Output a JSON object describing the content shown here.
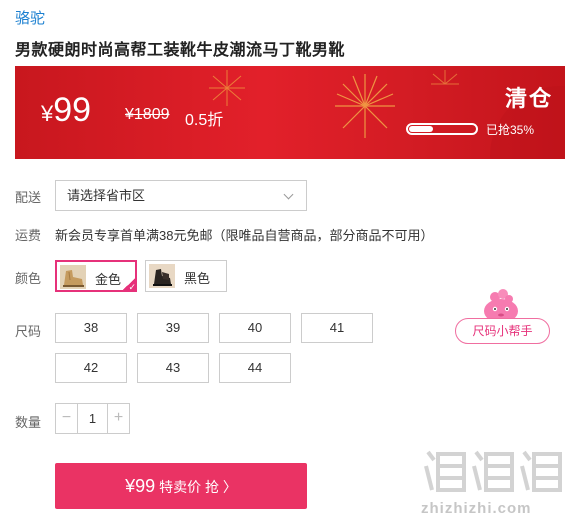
{
  "product": {
    "brand": "骆驼",
    "title": "男款硬朗时尚高帮工装靴牛皮潮流马丁靴男靴"
  },
  "banner": {
    "currency": "¥",
    "price": "99",
    "original_price": "¥1809",
    "discount": "0.5折",
    "clearance_label": "清仓",
    "sold_text": "已抢35%",
    "sold_progress_pct": 35
  },
  "delivery": {
    "label": "配送",
    "region_value": "请选择省市区"
  },
  "shipping": {
    "label": "运费",
    "text": "新会员专享首单满38元免邮（限唯品自营商品，部分商品不可用）"
  },
  "colors": {
    "label": "颜色",
    "options": [
      {
        "name": "金色",
        "selected": true
      },
      {
        "name": "黑色",
        "selected": false
      }
    ]
  },
  "sizes": {
    "label": "尺码",
    "options": [
      "38",
      "39",
      "40",
      "41",
      "42",
      "43",
      "44"
    ],
    "helper_label": "尺码小帮手"
  },
  "quantity": {
    "label": "数量",
    "minus": "−",
    "plus": "+",
    "value": "1"
  },
  "buy_button": {
    "price": "¥99",
    "text": "特卖价 抢 〉"
  },
  "watermark": {
    "text": "zhizhizhi.com"
  },
  "colors_theme": {
    "accent": "#ea3364",
    "banner_red": "#d41c24",
    "link_blue": "#1a7fd0"
  },
  "icons": [
    "chevron-down-icon",
    "check-icon",
    "mascot-icon",
    "watermark-logo"
  ]
}
